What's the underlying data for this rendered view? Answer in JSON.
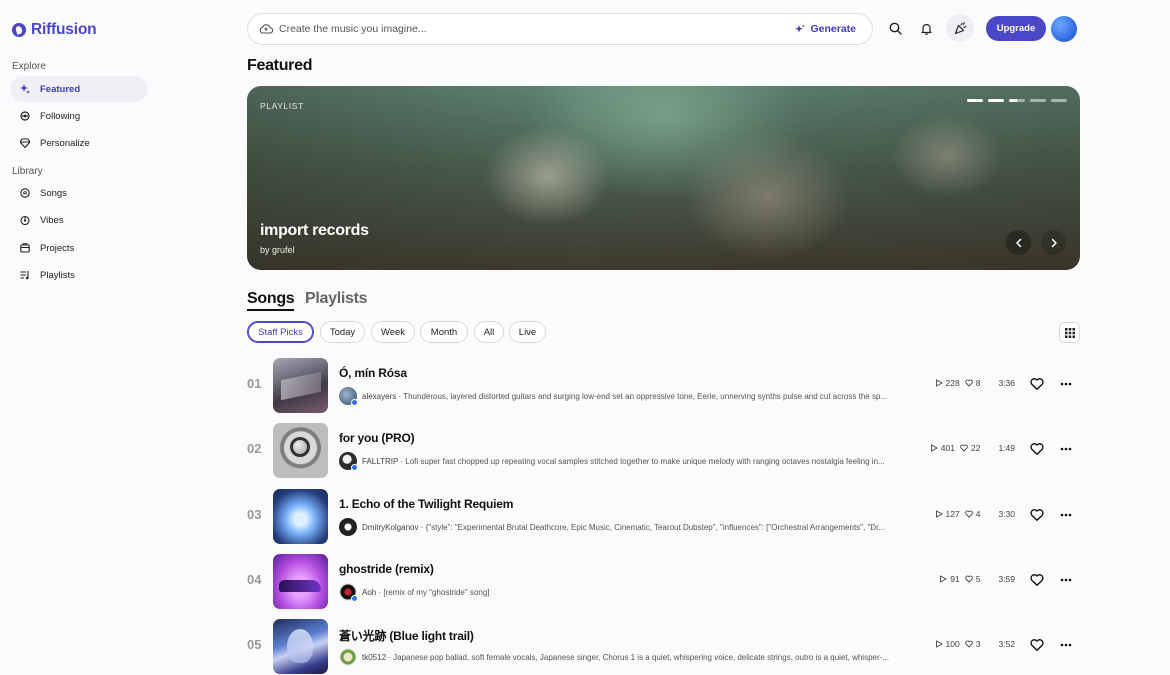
{
  "app": {
    "name": "Riffusion"
  },
  "sidebar": {
    "explore_label": "Explore",
    "library_label": "Library",
    "explore_items": [
      {
        "label": "Featured",
        "icon": "sparkle-icon",
        "active": true
      },
      {
        "label": "Following",
        "icon": "following-icon",
        "active": false
      },
      {
        "label": "Personalize",
        "icon": "gem-icon",
        "active": false
      }
    ],
    "library_items": [
      {
        "label": "Songs",
        "icon": "music-note-icon"
      },
      {
        "label": "Vibes",
        "icon": "vibes-icon"
      },
      {
        "label": "Projects",
        "icon": "folder-icon"
      },
      {
        "label": "Playlists",
        "icon": "playlist-icon"
      }
    ]
  },
  "topbar": {
    "search_placeholder": "Create the music you imagine...",
    "generate_label": "Generate",
    "upgrade_label": "Upgrade"
  },
  "featured": {
    "heading": "Featured",
    "tag": "PLAYLIST",
    "title": "import records",
    "byline": "by grufel",
    "slides_total": 5,
    "slide_active": 3
  },
  "tabs": {
    "songs": "Songs",
    "playlists": "Playlists"
  },
  "filters": [
    "Staff Picks",
    "Today",
    "Week",
    "Month",
    "All",
    "Live"
  ],
  "active_filter": "Staff Picks",
  "songs": [
    {
      "rank": "01",
      "title": "Ó, mín Rósa",
      "user": "alexayers",
      "description": "Thunderous, layered distorted guitars and surging low-end set an oppressive tone, Eerie, unnerving synths pulse and cut across the sp...",
      "plays": "228",
      "likes": "8",
      "duration": "3:36",
      "verified": true
    },
    {
      "rank": "02",
      "title": "for you (PRO)",
      "user": "FALLTRIP",
      "description": "Lofi super fast chopped up repeating vocal samples stitched together to make unique melody with ranging octaves nostalgia feeling in...",
      "plays": "401",
      "likes": "22",
      "duration": "1:49",
      "verified": true
    },
    {
      "rank": "03",
      "title": "1. Echo of the Twilight Requiem",
      "user": "DmitryKolganov",
      "description": "{\"style\": \"Experimental Brutal Deathcore, Epic Music, Cinematic, Tearout Dubstep\", \"influences\": [\"Orchestral Arrangements\", \"Dr...",
      "plays": "127",
      "likes": "4",
      "duration": "3:30",
      "verified": false
    },
    {
      "rank": "04",
      "title": "ghostride (remix)",
      "user": "Aoh",
      "description": "[remix of my \"ghostride\" song]",
      "plays": "91",
      "likes": "5",
      "duration": "3:59",
      "verified": true
    },
    {
      "rank": "05",
      "title": "蒼い光跡 (Blue light trail)",
      "user": "tk0512",
      "description": "Japanese pop ballad, soft female vocals, Japanese singer, Chorus 1 is a quiet, whispering voice, delicate strings, outro is a quiet, whisper-...",
      "plays": "100",
      "likes": "3",
      "duration": "3:52",
      "verified": false
    }
  ],
  "colors": {
    "accent": "#4a47c9",
    "background": "#fbfbfd"
  }
}
